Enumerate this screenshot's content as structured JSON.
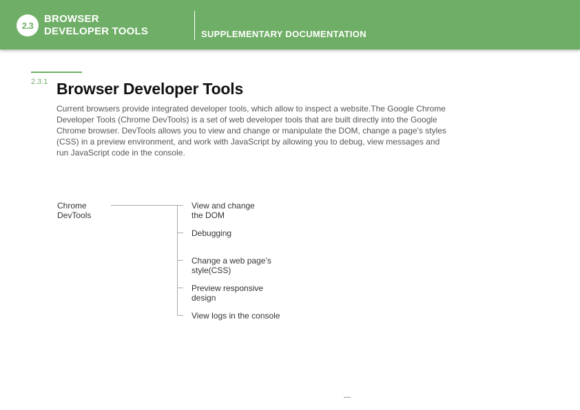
{
  "header": {
    "badge": "2.3",
    "title_line1": "BROWSER",
    "title_line2": "DEVELOPER TOOLS",
    "subtitle": "SUPPLEMENTARY DOCUMENTATION"
  },
  "section": {
    "number": "2.3.1",
    "title": "Browser Developer Tools",
    "body": "Current browsers provide integrated developer tools, which allow to inspect a website.The Google Chrome Developer Tools (Chrome DevTools) is a set of web developer tools that are built directly into the Google Chrome browser. DevTools allows you to view and change or manipulate the DOM, change a page's styles (CSS) in a preview environment, and work with JavaScript by allowing you to debug, view messages and run JavaScript code in the console."
  },
  "diagram": {
    "root": "Chrome DevTools",
    "items": [
      "View and change\nthe DOM",
      "Debugging",
      "Change a web page’s\nstyle(CSS)",
      "Preview responsive\ndesign",
      "View logs in the console"
    ]
  },
  "colors": {
    "accent": "#6fae66",
    "text": "#333333"
  }
}
